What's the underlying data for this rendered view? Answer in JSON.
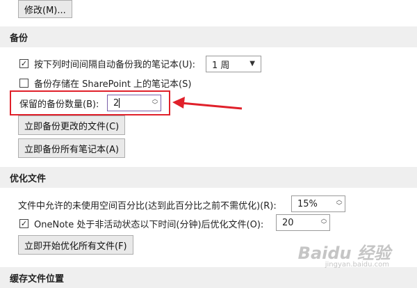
{
  "top_button": {
    "label": "修改(M)..."
  },
  "backup": {
    "section_title": "备份",
    "auto_backup": {
      "checked": true,
      "label": "按下列时间间隔自动备份我的笔记本(U):",
      "interval_value": "1 周"
    },
    "sharepoint": {
      "checked": false,
      "label": "备份存储在 SharePoint 上的笔记本(S)"
    },
    "keep_count": {
      "label": "保留的备份数量(B):",
      "value": "2"
    },
    "backup_changed_button": "立即备份更改的文件(C)",
    "backup_all_button": "立即备份所有笔记本(A)"
  },
  "optimize": {
    "section_title": "优化文件",
    "unused_space": {
      "label": "文件中允许的未使用空间百分比(达到此百分比之前不需优化)(R):",
      "value": "15%"
    },
    "inactive": {
      "checked": true,
      "label": "OneNote 处于非活动状态以下时间(分钟)后优化文件(O):",
      "value": "20"
    },
    "optimize_all_button": "立即开始优化所有文件(F)"
  },
  "cache": {
    "section_title": "缓存文件位置"
  },
  "watermark": {
    "text": "Baidu 经验",
    "sub": "jingyan.baidu.com"
  },
  "colors": {
    "highlight": "#e0202a",
    "section_bg": "#efefef"
  }
}
